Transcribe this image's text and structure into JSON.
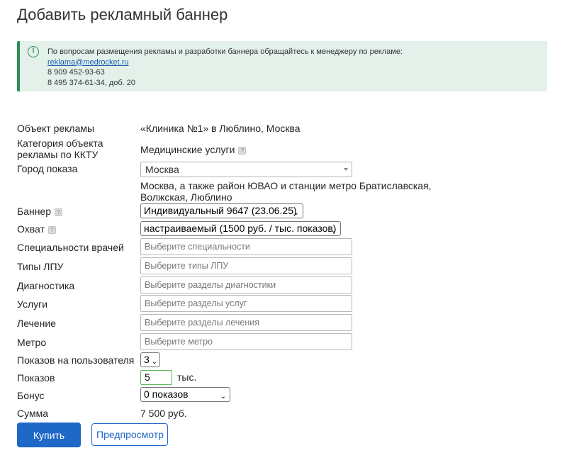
{
  "page": {
    "title": "Добавить рекламный баннер"
  },
  "alert": {
    "text": "По вопросам размещения рекламы и разработки баннера обращайтесь к менеджеру по рекламе:",
    "email": "reklama@medrocket.ru",
    "phone1": "8 909 452-93-63",
    "phone2": "8 495 374-61-34, доб. 20"
  },
  "form": {
    "object": {
      "label": "Объект рекламы",
      "value": "«Клиника №1» в Люблино, Москва"
    },
    "category": {
      "label": "Категория объекта рекламы по ККТУ",
      "value": "Медицинские услуги"
    },
    "city": {
      "label": "Город показа",
      "value": "Москва",
      "note": "Москва, а также район ЮВАО и станции метро Братиславская, Волжская, Люблино"
    },
    "banner": {
      "label": "Баннер",
      "value": "Индивидуальный 9647 (23.06.25)"
    },
    "reach": {
      "label": "Охват",
      "value": "настраиваемый (1500 руб. / тыс. показов)"
    },
    "specialties": {
      "label": "Специальности врачей",
      "placeholder": "Выберите специальности"
    },
    "lpu_types": {
      "label": "Типы ЛПУ",
      "placeholder": "Выберите типы ЛПУ"
    },
    "diagnostics": {
      "label": "Диагностика",
      "placeholder": "Выберите разделы диагностики"
    },
    "services": {
      "label": "Услуги",
      "placeholder": "Выберите разделы услуг"
    },
    "treatment": {
      "label": "Лечение",
      "placeholder": "Выберите разделы лечения"
    },
    "metro": {
      "label": "Метро",
      "placeholder": "Выберите метро"
    },
    "per_user": {
      "label": "Показов на пользователя",
      "value": "3"
    },
    "impressions": {
      "label": "Показов",
      "value": "5",
      "unit": "тыс."
    },
    "bonus": {
      "label": "Бонус",
      "value": "0 показов"
    },
    "total": {
      "label": "Сумма",
      "value": "7 500 руб."
    }
  },
  "actions": {
    "buy_label": "Купить",
    "preview_label": "Предпросмотр"
  },
  "colors": {
    "primary": "#1e68c7",
    "alert_bg": "#e3f1ea",
    "alert_accent": "#2e8b57",
    "focus_border": "#5cb85c"
  }
}
